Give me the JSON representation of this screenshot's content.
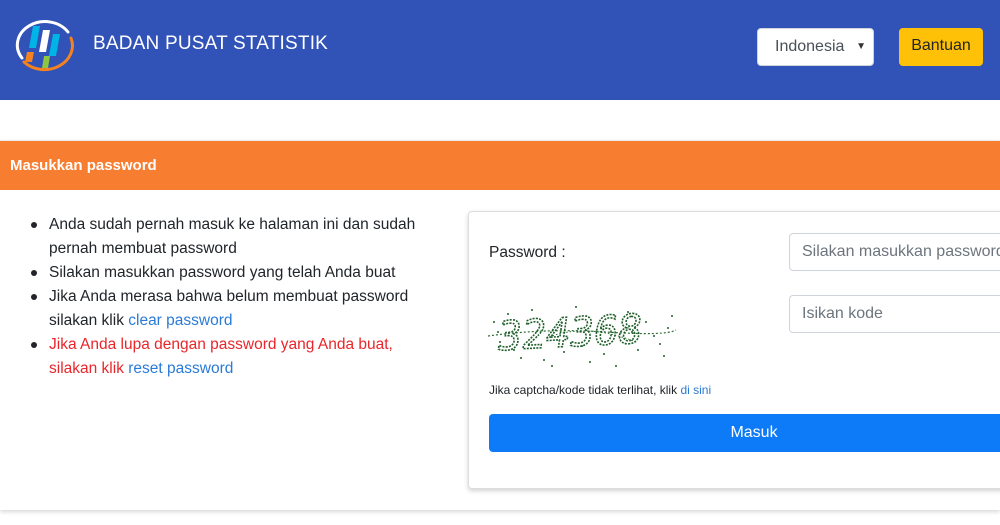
{
  "header": {
    "brand": "BADAN PUSAT STATISTIK",
    "language_selected": "Indonesia",
    "help_label": "Bantuan"
  },
  "card": {
    "title": "Masukkan password",
    "info": {
      "item1": "Anda sudah pernah masuk ke halaman ini dan sudah pernah membuat password",
      "item2": "Silakan masukkan password yang telah Anda buat",
      "item3_text": "Jika Anda merasa bahwa belum membuat password silakan klik ",
      "item3_link": "clear password",
      "item4_text": "Jika Anda lupa dengan password yang Anda buat, silakan klik ",
      "item4_link": "reset password"
    },
    "form": {
      "password_label": "Password :",
      "password_placeholder": "Silakan masukkan password",
      "captcha_text": "324368",
      "code_placeholder": "Isikan kode",
      "captcha_note": "Jika captcha/kode tidak terlihat, klik ",
      "captcha_note_link": "di sini",
      "submit_label": "Masuk"
    }
  },
  "colors": {
    "header_bg": "#3152b7",
    "card_header_bg": "#f77d31",
    "help_button": "#ffc107",
    "submit_button": "#0d7bf7",
    "warning_text": "#e8262b",
    "link": "#2a7bd6"
  },
  "icons": {
    "logo": "bps-logo",
    "select_caret": "caret-down-icon"
  }
}
